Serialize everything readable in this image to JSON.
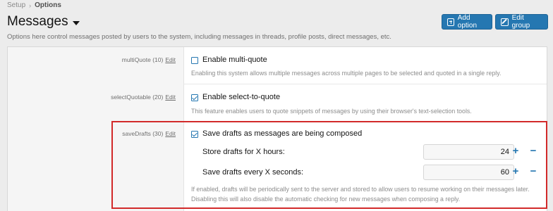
{
  "breadcrumb": {
    "items": [
      "Setup",
      "Options"
    ]
  },
  "page": {
    "title": "Messages",
    "description": "Options here control messages posted by users to the system, including messages in threads, profile posts, direct messages, etc."
  },
  "buttons": {
    "add_option": "Add option",
    "edit_group": "Edit group"
  },
  "options": {
    "multi_quote": {
      "id_label": "multiQuote (10)",
      "edit": "Edit",
      "label": "Enable multi-quote",
      "checked": false,
      "explain": "Enabling this system allows multiple messages across multiple pages to be selected and quoted in a single reply."
    },
    "select_quotable": {
      "id_label": "selectQuotable (20)",
      "edit": "Edit",
      "label": "Enable select-to-quote",
      "checked": true,
      "explain": "This feature enables users to quote snippets of messages by using their browser's text-selection tools."
    },
    "save_drafts": {
      "id_label": "saveDrafts (30)",
      "edit": "Edit",
      "label": "Save drafts as messages are being composed",
      "checked": true,
      "hours_label": "Store drafts for X hours:",
      "hours_value": "24",
      "seconds_label": "Save drafts every X seconds:",
      "seconds_value": "60",
      "explain": "If enabled, drafts will be periodically sent to the server and stored to allow users to resume working on their messages later. Disabling this will also disable the automatic checking for new messages when composing a reply."
    }
  },
  "stepper": {
    "plus": "+",
    "minus": "−"
  },
  "colors": {
    "accent": "#2577b1",
    "highlight": "#d22a2a"
  }
}
